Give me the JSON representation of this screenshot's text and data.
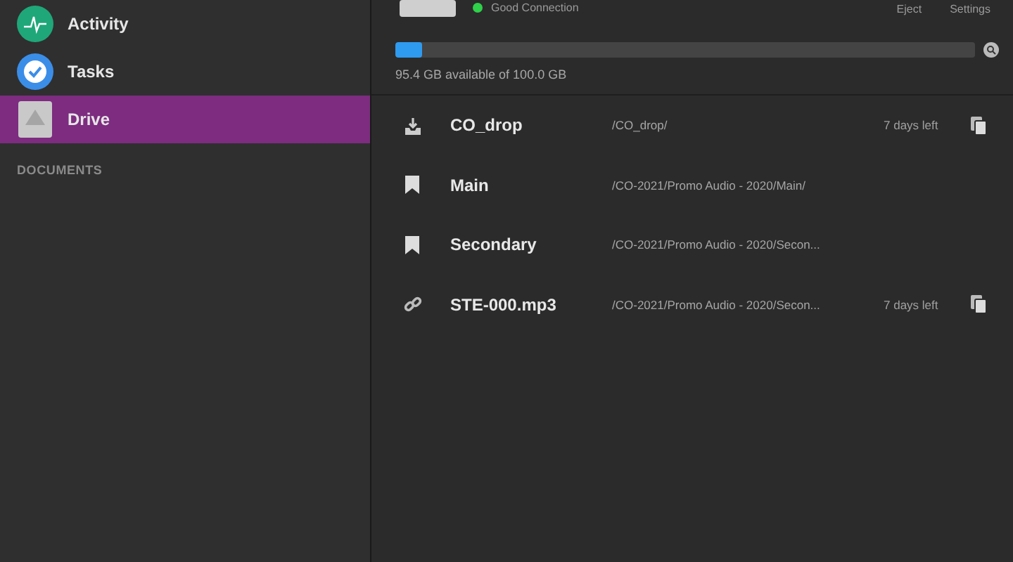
{
  "sidebar": {
    "items": [
      {
        "label": "Activity",
        "kind": "activity",
        "selected": false
      },
      {
        "label": "Tasks",
        "kind": "tasks",
        "selected": false
      },
      {
        "label": "Drive",
        "kind": "drive",
        "selected": true
      }
    ],
    "section_heading": "DOCUMENTS"
  },
  "drive": {
    "status": "Good Connection",
    "connected": true,
    "actions": [
      "Eject",
      "Settings"
    ],
    "storage": {
      "level": 0.046,
      "caption": "95.4 GB available of 100.0 GB"
    }
  },
  "files": [
    {
      "kind": "download",
      "name": "CO_drop",
      "path": "/CO_drop/",
      "expiry": "7 days left"
    },
    {
      "kind": "bookmark",
      "name": "Main",
      "path": "/CO-2021/Promo Audio - 2020/Main/"
    },
    {
      "kind": "bookmark",
      "name": "Secondary",
      "path": "/CO-2021/Promo Audio - 2020/Secon..."
    },
    {
      "kind": "link",
      "name": "STE-000.mp3",
      "path": "/CO-2021/Promo Audio - 2020/Secon...",
      "expiry": "7 days left"
    }
  ]
}
